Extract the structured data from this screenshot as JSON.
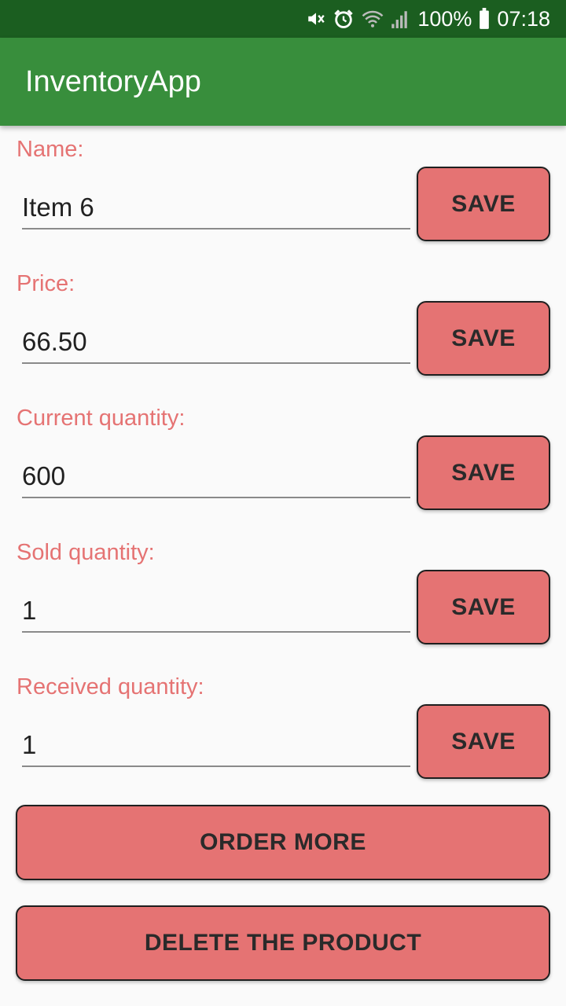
{
  "status_bar": {
    "battery": "100%",
    "time": "07:18",
    "icons": [
      "mute-icon",
      "alarm-icon",
      "wifi-icon",
      "signal-icon",
      "battery-icon"
    ]
  },
  "app_bar": {
    "title": "InventoryApp"
  },
  "fields": [
    {
      "label": "Name:",
      "value": "Item 6",
      "save_label": "SAVE"
    },
    {
      "label": "Price:",
      "value": "66.50",
      "save_label": "SAVE"
    },
    {
      "label": "Current quantity:",
      "value": "600",
      "save_label": "SAVE"
    },
    {
      "label": "Sold quantity:",
      "value": "1",
      "save_label": "SAVE"
    },
    {
      "label": "Received quantity:",
      "value": "1",
      "save_label": "SAVE"
    }
  ],
  "actions": {
    "order_more": "ORDER MORE",
    "delete_product": "DELETE THE PRODUCT"
  },
  "colors": {
    "status_bar": "#1b5e20",
    "app_bar": "#388e3c",
    "accent": "#e57373",
    "background": "#fafafa"
  }
}
